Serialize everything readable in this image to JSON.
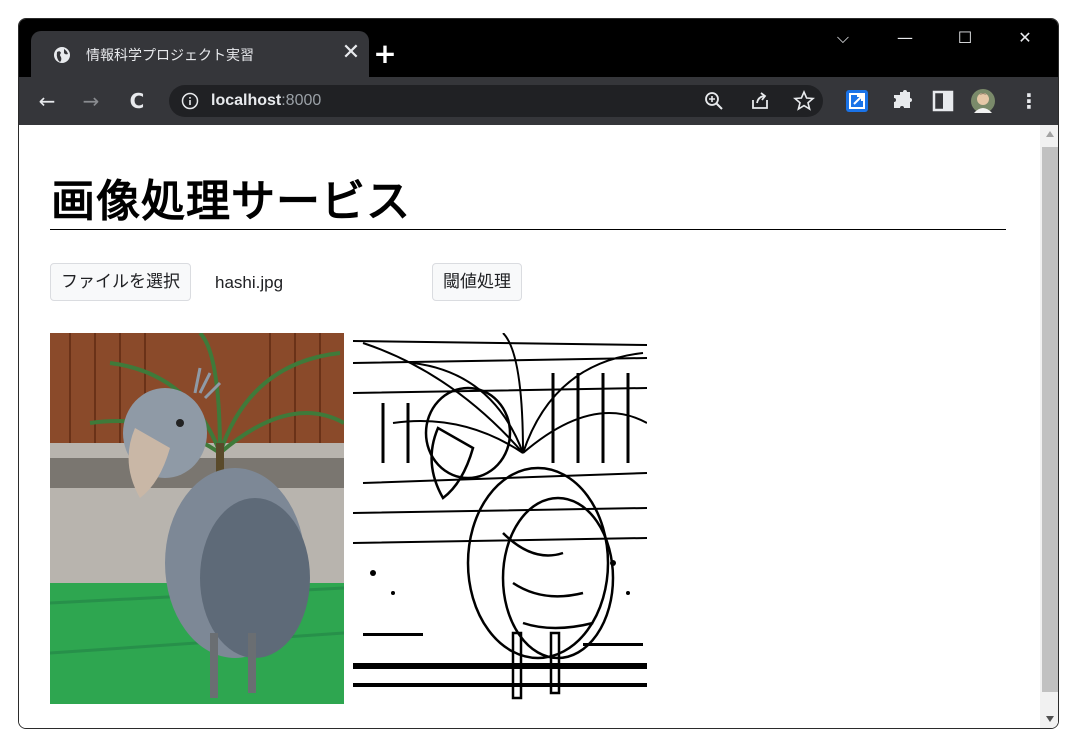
{
  "tab": {
    "title": "情報科学プロジェクト実習",
    "close_glyph": "✕",
    "new_tab_glyph": "+"
  },
  "window_controls": {
    "dropdown": "⌵",
    "minimize": "—",
    "maximize": "☐",
    "close": "✕"
  },
  "toolbar": {
    "back": "←",
    "forward": "→",
    "reload": "C",
    "url_host": "localhost",
    "url_port": ":8000",
    "zoom_icon": "zoom-in-icon",
    "share_icon": "share-icon",
    "bookmark_icon": "star-icon",
    "menu_glyph": "⋮"
  },
  "page": {
    "title": "画像処理サービス",
    "file_button": "ファイルを選択",
    "file_name": "hashi.jpg",
    "threshold_button": "閾値処理"
  },
  "images": [
    {
      "name": "original-image",
      "description": "shoebill bird photo"
    },
    {
      "name": "threshold-image",
      "description": "thresholded black-and-white result"
    }
  ],
  "colors": {
    "tabstrip": "#000000",
    "toolbar": "#35363a",
    "omnibox": "#202124",
    "page_bg": "#ffffff",
    "extension_blue": "#1a73e8"
  }
}
